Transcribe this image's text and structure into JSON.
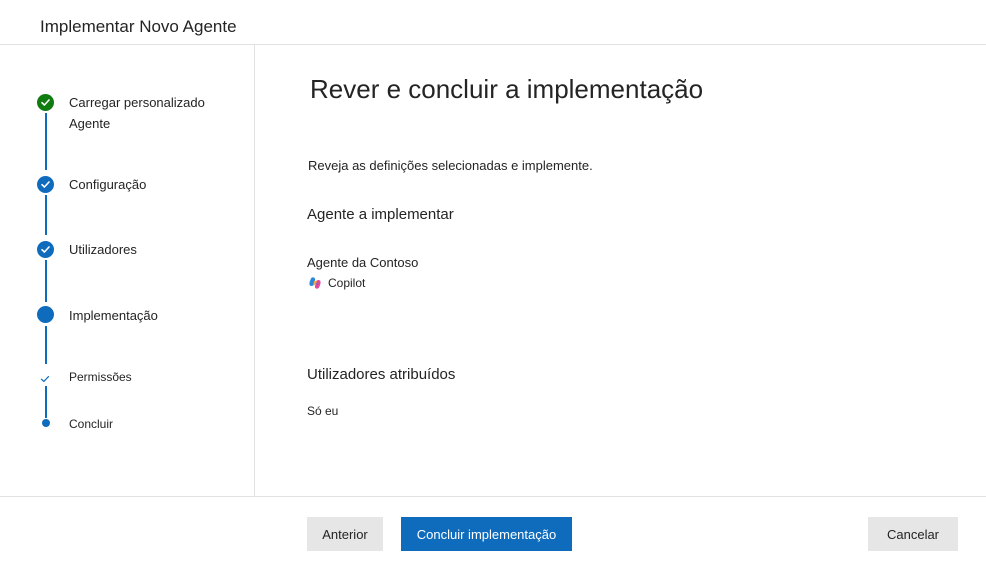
{
  "window": {
    "title": "Implementar Novo Agente"
  },
  "steps": [
    {
      "label_line1": "Carregar personalizado",
      "label_line2": "Agente",
      "state": "done",
      "color": "#107c10"
    },
    {
      "label": "Configuração",
      "state": "done",
      "color": "#0f6cbd"
    },
    {
      "label": "Utilizadores",
      "state": "done",
      "color": "#0f6cbd"
    },
    {
      "label": "Implementação",
      "state": "current",
      "color": "#0f6cbd"
    },
    {
      "label": "Permissões",
      "state": "sub-done"
    },
    {
      "label": "Concluir",
      "state": "sub-pending"
    }
  ],
  "main": {
    "title": "Rever e concluir a implementação",
    "description": "Reveja as definições selecionadas e implemente.",
    "agent_section": {
      "heading": "Agente a implementar",
      "agent_name": "Agente da Contoso",
      "app_icon": "copilot-icon",
      "app_name": "Copilot"
    },
    "users_section": {
      "heading": "Utilizadores atribuídos",
      "value": "Só eu"
    }
  },
  "footer": {
    "back_label": "Anterior",
    "primary_label": "Concluir implementação",
    "cancel_label": "Cancelar"
  },
  "colors": {
    "accent": "#0f6cbd",
    "success": "#107c10"
  }
}
